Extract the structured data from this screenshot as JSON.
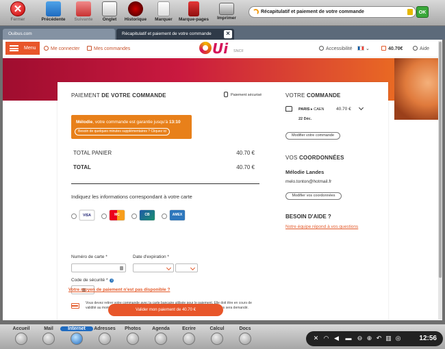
{
  "toolbar": {
    "close_label": "Fermer",
    "back_label": "Précédente",
    "next_label": "Suivante",
    "onglet_label": "Onglet",
    "history_label": "Historique",
    "bookmark_label": "Marquer",
    "bookmarks_label": "Marque-pages",
    "print_label": "Imprimer",
    "url_text": "Récapitulatif et paiement de votre commande",
    "ok_label": "OK"
  },
  "tabs": [
    {
      "label": "Ouibus.com"
    },
    {
      "label": "Récapitulatif et paiement de votre commande"
    }
  ],
  "site_header": {
    "menu_label": "Menu",
    "login_label": "Me connecter",
    "orders_label": "Mes commandes",
    "logo_text": "Ui",
    "logo_sub": "SNCF",
    "accessibility_label": "Accessibilité",
    "cart_total": "40.70€",
    "help_label": "Aide"
  },
  "payment": {
    "title_pre": "PAIEMENT",
    "title_bold": "DE VOTRE COMMANDE",
    "secure_label": "Paiement sécurisé",
    "timer_text_name": "Mélodie",
    "timer_text_mid": ", votre commande est garantie jusqu'à",
    "timer_time": "13:10",
    "timer_more": "Besoin de quelques minutes supplémentaires ? Cliquez ici",
    "total_panier_label": "TOTAL PANIER",
    "total_panier_value": "40.70 €",
    "total_label": "TOTAL",
    "total_value": "40.70 €",
    "card_info_title": "Indiquez les informations correspondant à votre carte",
    "brands": [
      "VISA",
      "MC",
      "CB",
      "AMEX"
    ],
    "card_number_label": "Numéro de carte *",
    "expiry_label": "Date d'expiration *",
    "cvv_label": "Code de sécurité *",
    "notice": "Vous devez retirer votre commande avec la carte bancaire utilisée pour le paiement. Elle doit être en cours de validité au moment du retrait en gare, boutique ou Borne Libre Service. Le code secret vous sera demandé.",
    "other_method": "Votre moyen de paiement n'est pas disponible ?",
    "validate_label": "Valider mon paiement de 40.70 €"
  },
  "order": {
    "title_pre": "VOTRE",
    "title_bold": "COMMANDE",
    "from": "PARIS",
    "to": "CAEN",
    "price": "40.70 €",
    "date": "22 Déc.",
    "modify_label": "Modifier votre commande"
  },
  "coords": {
    "title_pre": "VOS",
    "title_bold": "COORDONNÉES",
    "name": "Mélodie Landes",
    "email": "melo.tonton@hotmail.fr",
    "modify_label": "Modifier vos coordonnées"
  },
  "help": {
    "title": "BESOIN D'AIDE ?",
    "link": "Notre équipe répond à vos questions"
  },
  "dock": {
    "items": [
      {
        "label": "Accueil"
      },
      {
        "label": "Mail"
      },
      {
        "label": "Internet"
      },
      {
        "label": "Adresses"
      },
      {
        "label": "Photos"
      },
      {
        "label": "Agenda"
      },
      {
        "label": "Ecrire"
      },
      {
        "label": "Calcul"
      },
      {
        "label": "Docs"
      }
    ],
    "clock": "12:56"
  },
  "colors": {
    "accent": "#e8562a",
    "brand": "#d4145a",
    "timer": "#e8801a"
  }
}
